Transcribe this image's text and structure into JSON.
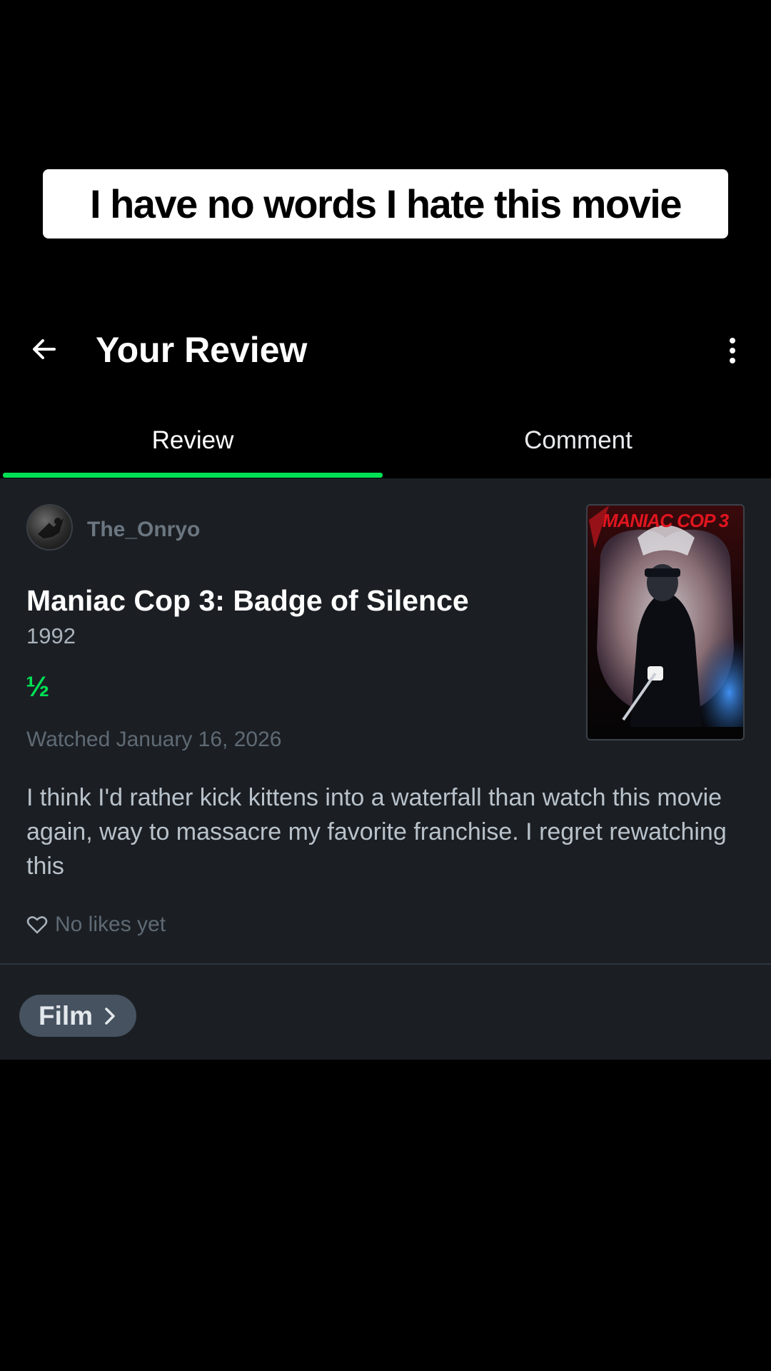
{
  "caption": "I have no words I hate this movie",
  "header": {
    "title": "Your Review",
    "back_icon": "arrow-left-icon",
    "more_icon": "more-vertical-icon"
  },
  "tabs": [
    {
      "label": "Review",
      "active": true
    },
    {
      "label": "Comment",
      "active": false
    }
  ],
  "review": {
    "username": "The_Onryo",
    "movie_title": "Maniac Cop 3: Badge of Silence",
    "year": "1992",
    "rating_display": "½",
    "rating_value": 0.5,
    "watched": "Watched January 16, 2026",
    "text": "I think I'd rather kick kittens into a waterfall than watch this movie again, way to massacre my favorite franchise. I regret rewatching this",
    "likes": "No likes yet",
    "poster_title": "MANIAC COP 3"
  },
  "chip": {
    "label": "Film",
    "icon": "chevron-right-icon"
  },
  "colors": {
    "accent": "#00e054",
    "card_bg": "#1b1f24",
    "page_bg": "#000000"
  }
}
